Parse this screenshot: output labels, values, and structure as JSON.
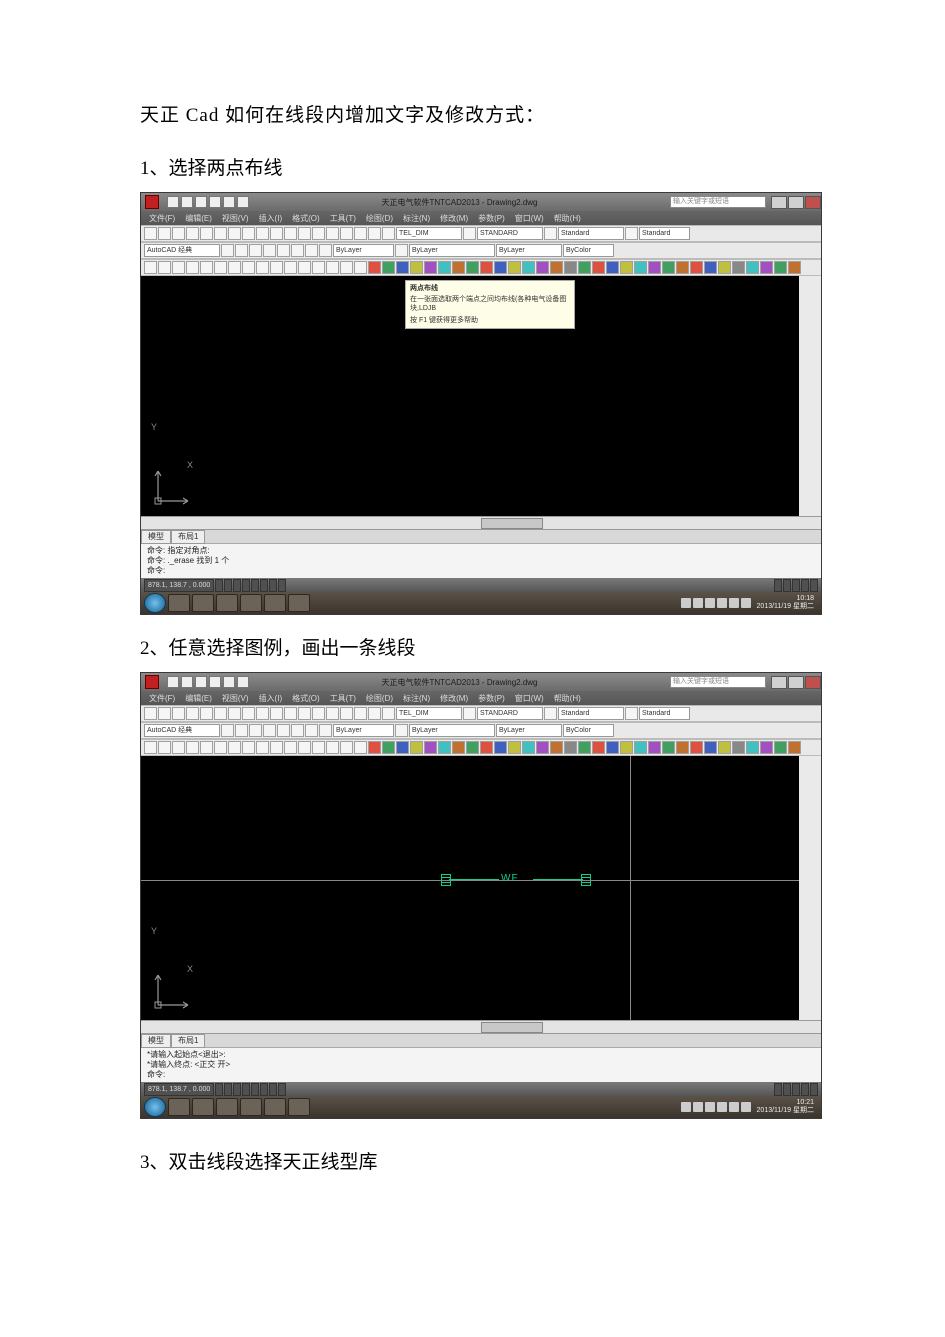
{
  "doc": {
    "title": "天正 Cad  如何在线段内增加文字及修改方式：",
    "step1": "1、选择两点布线",
    "step2": "2、任意选择图例，画出一条线段",
    "step3": "3、双击线段选择天正线型库"
  },
  "cad": {
    "titlebar_center": "天正电气软件TNTCAD2013 - Drawing2.dwg",
    "search_placeholder": "输入关键字或短语",
    "menus": [
      "文件(F)",
      "编辑(E)",
      "视图(V)",
      "插入(I)",
      "格式(O)",
      "工具(T)",
      "绘图(D)",
      "标注(N)",
      "修改(M)",
      "参数(P)",
      "窗口(W)",
      "帮助(H)"
    ],
    "dropdown_workspace": "AutoCAD 经典",
    "layer_sel": "ByLayer",
    "dim_sel": "TEL_DIM",
    "std_sel": "STANDARD",
    "std_sel2": "Standard",
    "lt_sel": "ByLayer",
    "lw_sel": "ByLayer",
    "color_sel": "ByColor",
    "model_tab": "模型",
    "layout_tab": "布局1",
    "ucs_x": "X",
    "ucs_y": "Y",
    "tooltip_title": "两点布线",
    "tooltip_body": "在一张面选取两个端点之间均布线(各种电气设备图块,LDJB",
    "tooltip_help": "按 F1 键获得更多帮助",
    "cmd1_l1": "命令: 指定对角点:",
    "cmd1_l2": "命令: ._erase 找到 1 个",
    "cmd1_l3": "命令:",
    "status_coords": "878.1, 138.7 , 0.000",
    "taskbar_date": "10:18",
    "taskbar_day": "2013/11/19 星期二"
  },
  "cad2": {
    "wf_label": "WF",
    "cmd_l1": "*请输入起始点<退出>:",
    "cmd_l2": "*请输入终点: <正交 开>",
    "cmd_l3": "命令:",
    "taskbar_date": "10:21",
    "taskbar_day": "2013/11/19 星期二"
  }
}
